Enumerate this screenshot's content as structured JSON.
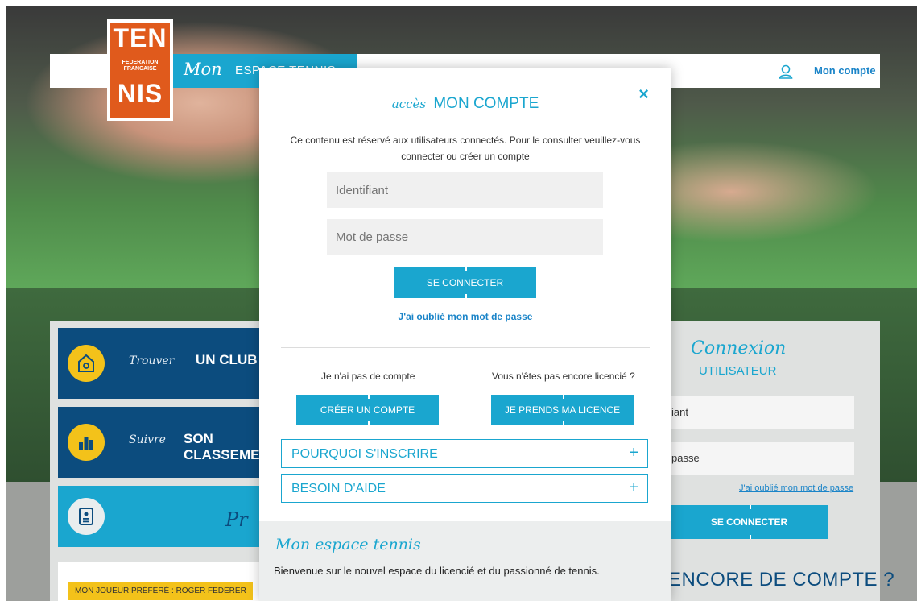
{
  "header": {
    "brand_script": "Mon",
    "brand_rest": "ESPACE TENNIS",
    "account_label": "Mon compte",
    "account_icon": "user-icon"
  },
  "logo": {
    "line1": "TEN",
    "fed1": "FEDERATION",
    "fed2": "FRANCAISE",
    "line2": "NIS"
  },
  "left_tiles": [
    {
      "script": "Trouver",
      "bold": "UN CLUB",
      "icon": "club-house-icon"
    },
    {
      "script": "Suivre",
      "bold": "SON CLASSEMENT",
      "icon": "ranking-icon"
    },
    {
      "script": "Pr",
      "icon": "licence-card-icon"
    }
  ],
  "favorite": {
    "badge": "MON JOUEUR PRÉFÉRÉ : ROGER FEDERER"
  },
  "right_panel": {
    "script": "Connexion",
    "title": "UTILISATEUR",
    "identifiant_value": "iant",
    "password_value": "passe",
    "forgot": "J'ai oublié mon mot de passe",
    "button": "SE CONNECTER",
    "headline": "ENCORE DE COMPTE ?"
  },
  "modal": {
    "title_script": "accès",
    "title": "MON COMPTE",
    "description_line1": "Ce contenu est réservé aux utilisateurs connectés. Pour le consulter veuillez-vous",
    "description_line2": "connecter ou créer un compte",
    "identifiant_placeholder": "Identifiant",
    "password_placeholder": "Mot de passe",
    "connect_button": "SE CONNECTER",
    "forgot_link": "J'ai oublié mon mot de passe",
    "no_account_label": "Je n'ai pas de compte",
    "not_licensed_label": "Vous n'êtes pas encore licencié ?",
    "create_account_button": "CRÉER UN COMPTE",
    "licence_button": "JE PRENDS MA LICENCE",
    "accordion": [
      {
        "label": "POURQUOI S'INSCRIRE",
        "symbol": "+"
      },
      {
        "label": "BESOIN D'AIDE",
        "symbol": "+"
      }
    ],
    "footer_script": "Mon espace tennis",
    "footer_text": "Bienvenue sur le nouvel espace du licencié et du passionné de tennis.",
    "close_symbol": "×"
  },
  "colors": {
    "accent": "#1aa6cf",
    "navy": "#0c4c7e",
    "logo_orange": "#e05a1c",
    "yellow": "#f3c21a"
  }
}
